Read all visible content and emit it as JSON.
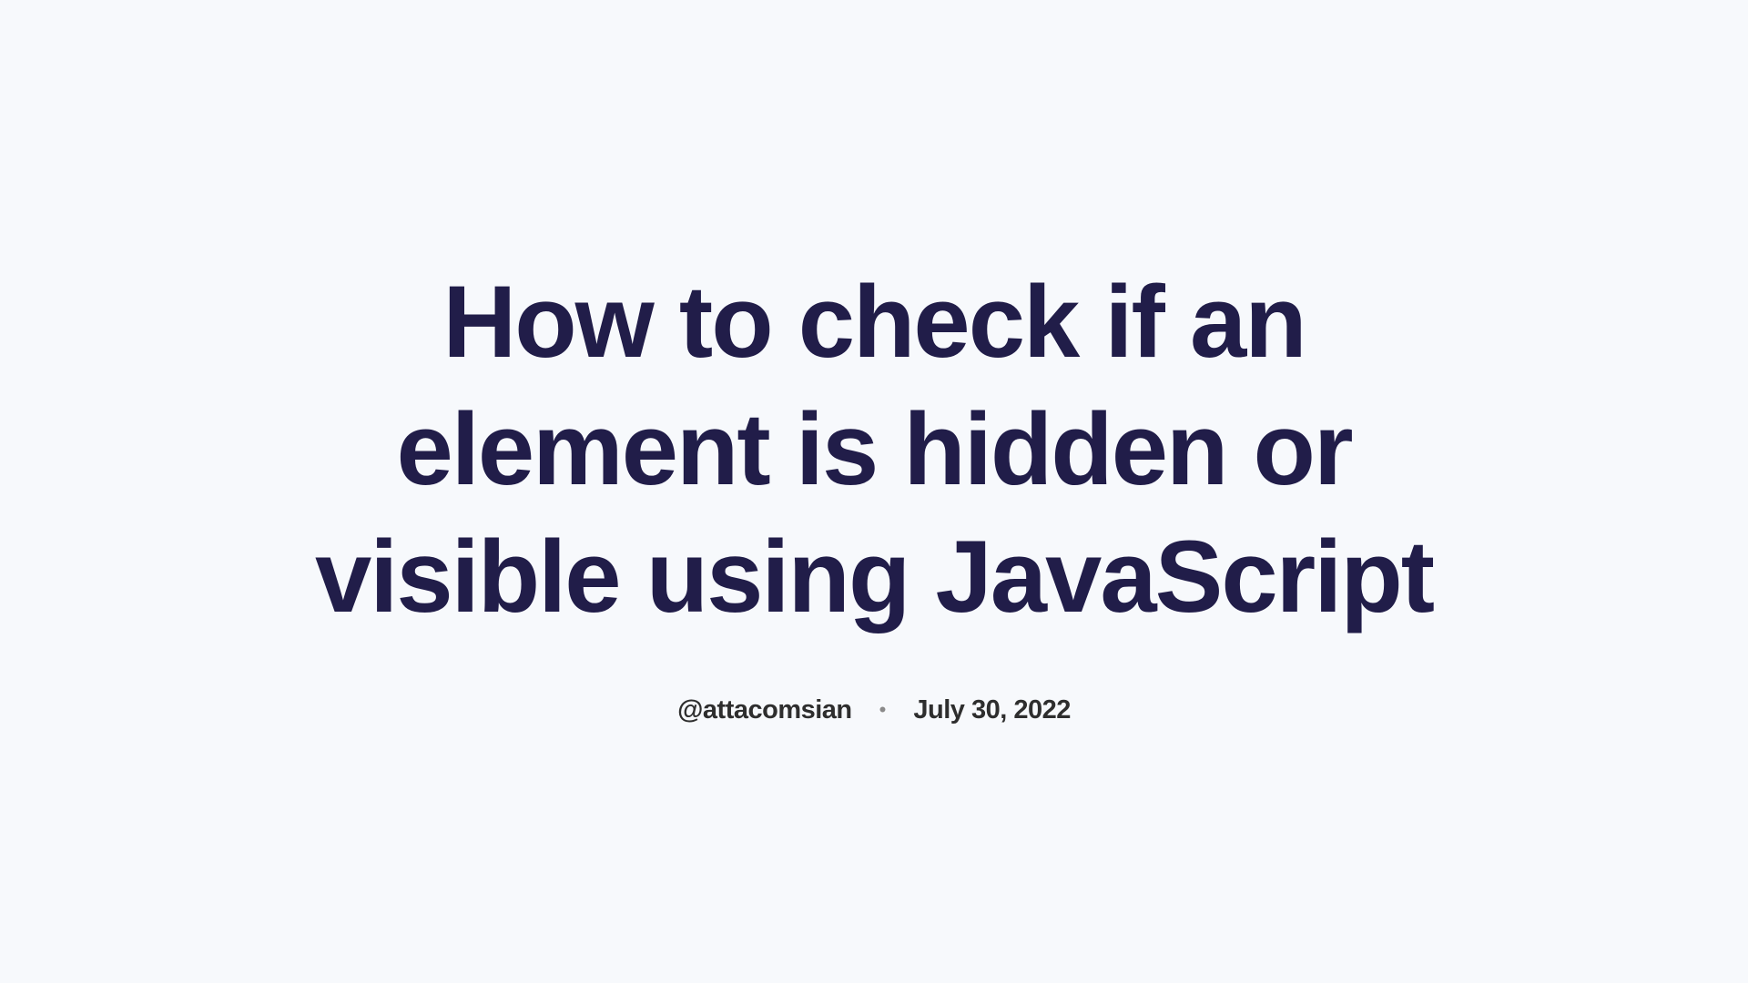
{
  "title": "How to check if an element is hidden or visible using JavaScript",
  "author": "@attacomsian",
  "separator": "•",
  "date": "July 30, 2022"
}
